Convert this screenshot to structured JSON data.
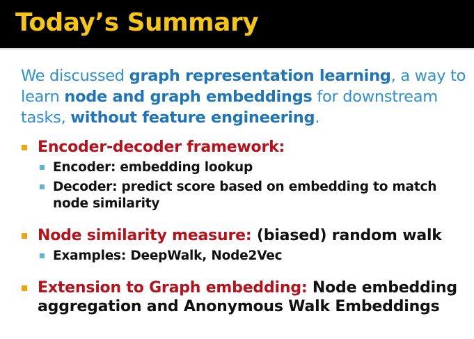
{
  "title": "Today’s Summary",
  "intro": {
    "t1": "We discussed ",
    "b1": "graph representation learning",
    "t2": ", a way to learn ",
    "b2": "node and graph embeddings",
    "t3": " for downstream tasks, ",
    "b3": "without feature engineering",
    "t4": "."
  },
  "bullets": [
    {
      "heading": "Encoder-decoder framework:",
      "rest": "",
      "subs": [
        "Encoder: embedding lookup",
        "Decoder: predict score based on embedding to match node similarity"
      ]
    },
    {
      "heading": "Node similarity measure:",
      "rest": " (biased) random walk",
      "subs": [
        "Examples: DeepWalk, Node2Vec"
      ]
    },
    {
      "heading": "Extension to Graph embedding:",
      "rest": " Node embedding aggregation and Anonymous Walk Embeddings",
      "subs": []
    }
  ],
  "colors": {
    "title": "#f5c518",
    "intro_text": "#2f8fd0",
    "heading_red": "#b5121b",
    "bullet_orange": "#f0a30a",
    "sub_bullet_blue": "#5db5d8"
  }
}
